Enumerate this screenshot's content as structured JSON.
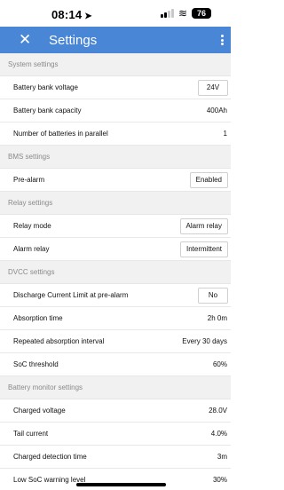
{
  "status_bar": {
    "time": "08:14",
    "battery": "76"
  },
  "header": {
    "close_icon": "close-icon",
    "title": "Settings",
    "more_icon": "more-vertical-icon"
  },
  "colors": {
    "accent": "#4a86d6"
  },
  "sections": [
    {
      "title": "System settings",
      "rows": [
        {
          "label": "Battery bank voltage",
          "value": "24V",
          "kind": "button"
        },
        {
          "label": "Battery bank capacity",
          "value": "400Ah",
          "kind": "text"
        },
        {
          "label": "Number of batteries in parallel",
          "value": "1",
          "kind": "text"
        }
      ]
    },
    {
      "title": "BMS settings",
      "rows": [
        {
          "label": "Pre-alarm",
          "value": "Enabled",
          "kind": "button"
        }
      ]
    },
    {
      "title": "Relay settings",
      "rows": [
        {
          "label": "Relay mode",
          "value": "Alarm relay",
          "kind": "button"
        },
        {
          "label": "Alarm relay",
          "value": "Intermittent",
          "kind": "button"
        }
      ]
    },
    {
      "title": "DVCC settings",
      "rows": [
        {
          "label": "Discharge Current Limit at pre-alarm",
          "value": "No",
          "kind": "button"
        },
        {
          "label": "Absorption time",
          "value": "2h 0m",
          "kind": "text"
        },
        {
          "label": "Repeated absorption interval",
          "value": "Every 30 days",
          "kind": "text"
        },
        {
          "label": "SoC threshold",
          "value": "60%",
          "kind": "text"
        }
      ]
    },
    {
      "title": "Battery monitor settings",
      "rows": [
        {
          "label": "Charged voltage",
          "value": "28.0V",
          "kind": "text"
        },
        {
          "label": "Tail current",
          "value": "4.0%",
          "kind": "text"
        },
        {
          "label": "Charged detection time",
          "value": "3m",
          "kind": "text"
        },
        {
          "label": "Low SoC warning level",
          "value": "30%",
          "kind": "text"
        }
      ]
    }
  ]
}
